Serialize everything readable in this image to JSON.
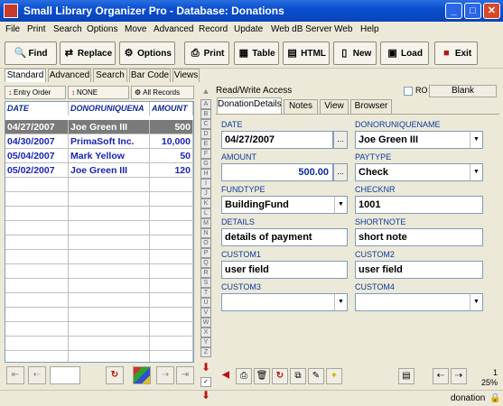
{
  "window": {
    "title": "Small Library Organizer Pro - Database: Donations",
    "controls": [
      "_",
      "□",
      "✕"
    ]
  },
  "menu": [
    "File",
    "Print",
    "Search",
    "Options",
    "Move",
    "Advanced",
    "Record",
    "Update",
    "Web dB Server",
    "Web",
    "Help"
  ],
  "toolbar": [
    {
      "label": "Find",
      "icon": "🔍"
    },
    {
      "label": "Replace",
      "icon": "⇄"
    },
    {
      "label": "Options",
      "icon": "⚙"
    },
    {
      "label": "Print",
      "icon": "⎙"
    },
    {
      "label": "Table",
      "icon": "▦"
    },
    {
      "label": "HTML",
      "icon": "▤"
    },
    {
      "label": "New",
      "icon": "▯"
    },
    {
      "label": "Load",
      "icon": "▣"
    },
    {
      "label": "Exit",
      "icon": "■"
    }
  ],
  "viewtabs": [
    "Standard",
    "Advanced",
    "Search",
    "Bar Code",
    "Views"
  ],
  "filters": [
    {
      "label": "Entry Order",
      "icon": "↕"
    },
    {
      "label": "NONE",
      "icon": "↕"
    },
    {
      "label": "All Records",
      "icon": "⚙"
    }
  ],
  "grid": {
    "headers": [
      "DATE",
      "DONORUNIQUENA",
      "AMOUNT"
    ],
    "rows": [
      [
        "04/27/2007",
        "Joe Green III",
        "500"
      ],
      [
        "04/30/2007",
        "PrimaSoft Inc.",
        "10,000"
      ],
      [
        "05/04/2007",
        "Mark Yellow",
        "50"
      ],
      [
        "05/02/2007",
        "Joe Green III",
        "120"
      ]
    ]
  },
  "alphabet": [
    "A",
    "B",
    "C",
    "D",
    "E",
    "F",
    "G",
    "H",
    "I",
    "J",
    "K",
    "L",
    "M",
    "N",
    "O",
    "P",
    "Q",
    "R",
    "S",
    "T",
    "U",
    "V",
    "W",
    "X",
    "Y",
    "Z"
  ],
  "right": {
    "access": "Read/Write Access",
    "ro_label": "RO",
    "blank_label": "Blank",
    "tabs": [
      "DonationDetails",
      "Notes",
      "View",
      "Browser"
    ]
  },
  "fields": {
    "date": {
      "label": "DATE",
      "value": "04/27/2007"
    },
    "donor": {
      "label": "DONORUNIQUENAME",
      "value": "Joe Green III"
    },
    "amount": {
      "label": "AMOUNT",
      "value": "500.00"
    },
    "paytype": {
      "label": "PAYTYPE",
      "value": "Check"
    },
    "fundtype": {
      "label": "FUNDTYPE",
      "value": "BuildingFund"
    },
    "checknr": {
      "label": "CHECKNR",
      "value": "1001"
    },
    "details": {
      "label": "DETAILS",
      "value": "details of payment"
    },
    "shortnote": {
      "label": "SHORTNOTE",
      "value": "short note"
    },
    "custom1": {
      "label": "CUSTOM1",
      "value": "user field"
    },
    "custom2": {
      "label": "CUSTOM2",
      "value": "user field"
    },
    "custom3": {
      "label": "CUSTOM3",
      "value": ""
    },
    "custom4": {
      "label": "CUSTOM4",
      "value": ""
    }
  },
  "footer": {
    "record_count": "1",
    "zoom": "25%",
    "status": "donation"
  }
}
